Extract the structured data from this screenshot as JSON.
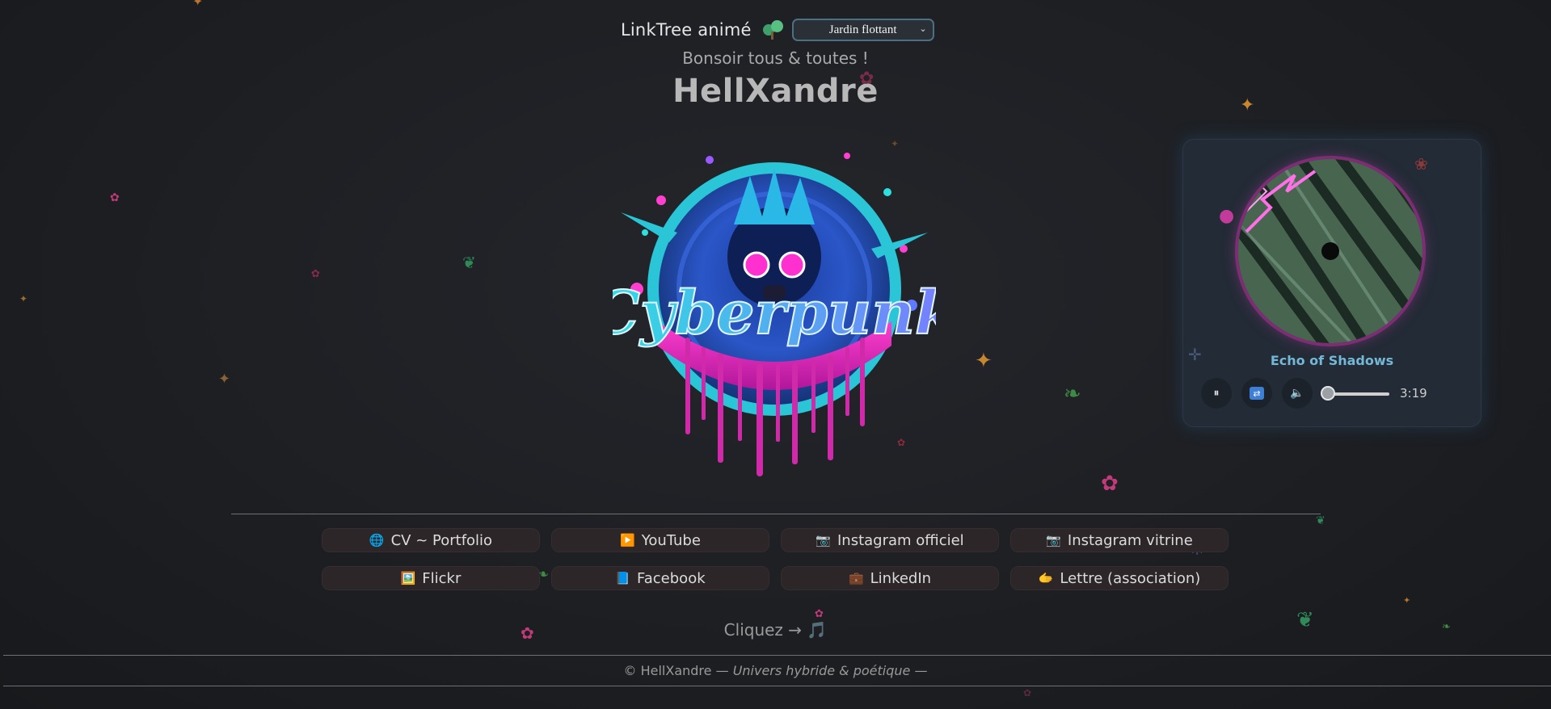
{
  "header": {
    "site_title": "LinkTree animé",
    "tree_icon": "tree-icon",
    "theme_select": {
      "selected": "Jardin flottant"
    }
  },
  "greeting": "Bonsoir tous & toutes !",
  "page_title": "HellXandre",
  "logo": {
    "icon": "cyberpunk-splash-logo",
    "text": "Cyberpunk"
  },
  "player": {
    "track_title": "Echo of Shadows",
    "pause_icon": "⏸",
    "shuffle_icon": "🔀",
    "volume_icon": "🔈",
    "progress": 0.05,
    "time": "3:19"
  },
  "links": [
    {
      "icon": "🌐",
      "label": "CV ~ Portfolio"
    },
    {
      "icon": "▶️",
      "label": "YouTube"
    },
    {
      "icon": "📷",
      "label": "Instagram officiel"
    },
    {
      "icon": "📷",
      "label": "Instagram vitrine"
    },
    {
      "icon": "🖼️",
      "label": "Flickr"
    },
    {
      "icon": "📘",
      "label": "Facebook"
    },
    {
      "icon": "💼",
      "label": "LinkedIn"
    },
    {
      "icon": "🫱",
      "label": "Lettre (association)"
    }
  ],
  "cta": {
    "text": "Cliquez →",
    "icon": "🎵"
  },
  "footer": {
    "copyright": "© HellXandre —",
    "tagline": "Univers hybride & poétique",
    "end": "—"
  },
  "colors": {
    "background": "#1e2024",
    "accent_pink": "#c2309a",
    "accent_blue": "#74b7d6",
    "player_bg": "#232b36"
  }
}
